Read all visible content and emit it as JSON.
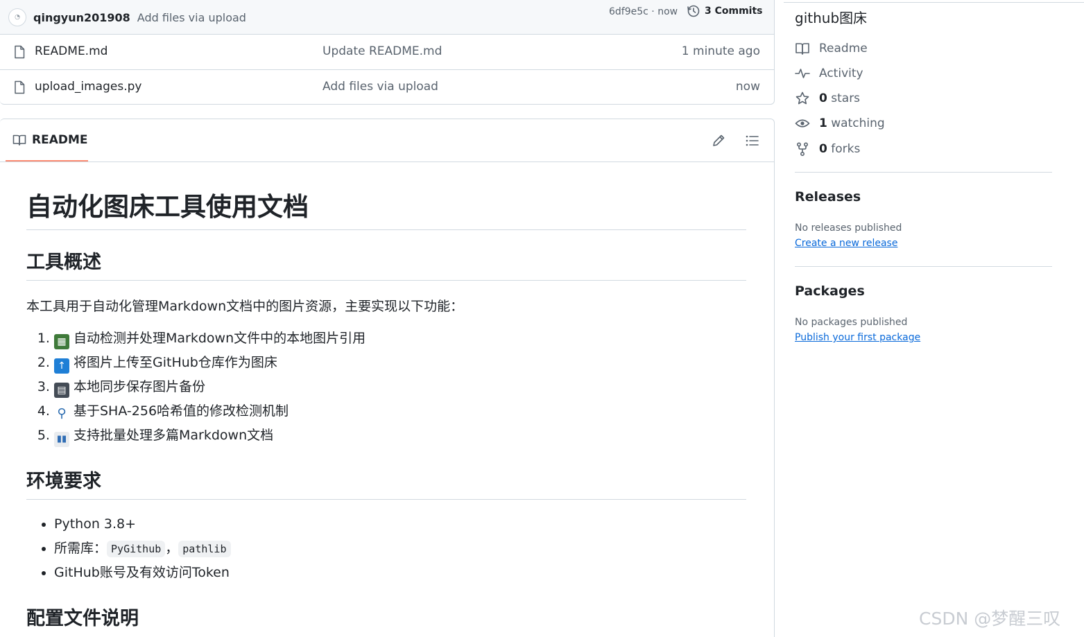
{
  "commit_bar": {
    "user": "qingyun201908",
    "message": "Add files via upload",
    "hash_time": "6df9e5c · now",
    "commits_label": "3 Commits"
  },
  "files": [
    {
      "name": "README.md",
      "commit": "Update README.md",
      "time": "1 minute ago",
      "icon": "file-icon"
    },
    {
      "name": "upload_images.py",
      "commit": "Add files via upload",
      "time": "now",
      "icon": "file-icon"
    }
  ],
  "readme": {
    "tab_label": "README",
    "h1": "自动化图床工具使用文档",
    "h2_overview": "工具概述",
    "intro": "本工具用于自动化管理Markdown文档中的图片资源，主要实现以下功能：",
    "features": [
      {
        "emoji": "framed-picture-icon",
        "text": "自动检测并处理Markdown文件中的本地图片引用"
      },
      {
        "emoji": "up-arrow-icon",
        "text": "将图片上传至GitHub仓库作为图床"
      },
      {
        "emoji": "floppy-disk-icon",
        "text": "本地同步保存图片备份"
      },
      {
        "emoji": "magnifier-icon",
        "text": "基于SHA-256哈希值的修改检测机制"
      },
      {
        "emoji": "bar-chart-icon",
        "text": "支持批量处理多篇Markdown文档"
      }
    ],
    "h2_env": "环境要求",
    "env_items": {
      "python": "Python 3.8+",
      "libs_prefix": "所需库：",
      "lib1": "PyGithub",
      "sep": "，",
      "lib2": "pathlib",
      "token": "GitHub账号及有效访问Token"
    },
    "h2_config": "配置文件说明"
  },
  "sidebar": {
    "about_title": "github图床",
    "readme_label": "Readme",
    "activity_label": "Activity",
    "stars_count": "0",
    "stars_label": " stars",
    "watching_count": "1",
    "watching_label": " watching",
    "forks_count": "0",
    "forks_label": " forks",
    "releases_heading": "Releases",
    "releases_note": "No releases published",
    "releases_link": "Create a new release",
    "packages_heading": "Packages",
    "packages_note": "No packages published",
    "packages_link": "Publish your first package"
  },
  "watermark": "CSDN @梦醒三叹",
  "colors": {
    "accent_underline": "#fd8c73",
    "link": "#0969da",
    "border": "#d1d9e0",
    "muted": "#59636e"
  }
}
